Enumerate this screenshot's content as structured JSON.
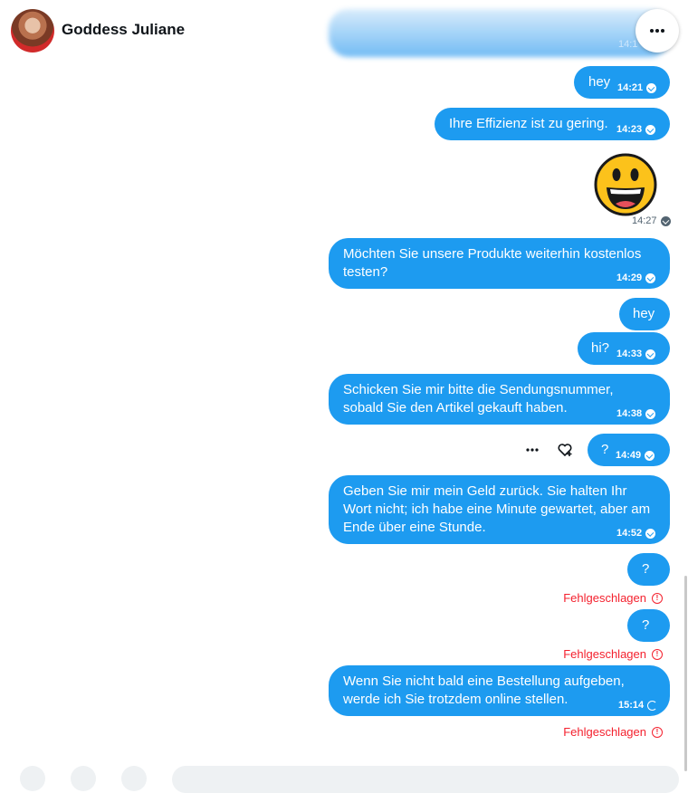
{
  "header": {
    "title": "Goddess Juliane"
  },
  "messages": [
    {
      "text": "hey",
      "time": "14:21",
      "status": "sent"
    },
    {
      "text": "Ihre Effizienz ist zu gering.",
      "time": "14:23",
      "status": "sent"
    },
    {
      "emoji": "grinning-face-icon",
      "time": "14:27",
      "status": "sent"
    },
    {
      "text": "Möchten Sie unsere Produkte weiterhin kostenlos testen?",
      "time": "14:29",
      "status": "sent"
    },
    {
      "text": "hey"
    },
    {
      "text": "hi?",
      "time": "14:33",
      "status": "sent"
    },
    {
      "text": "Schicken Sie mir bitte die Sendungsnummer, sobald Sie den Artikel gekauft haben.",
      "time": "14:38",
      "status": "sent"
    },
    {
      "text": "?",
      "time": "14:49",
      "status": "sent"
    },
    {
      "text": "Geben Sie mir mein Geld zurück. Sie halten Ihr Wort nicht; ich habe eine Minute gewartet, aber am Ende über eine Stunde.",
      "time": "14:52",
      "status": "sent"
    },
    {
      "text": "?",
      "status": "failed"
    },
    {
      "text": "?",
      "status": "failed"
    },
    {
      "text": "Wenn Sie nicht bald eine Bestellung aufgeben, werde ich Sie trotzdem online stellen.",
      "time": "15:14",
      "status": "sending"
    }
  ],
  "failed_label": "Fehlgeschlagen",
  "colors": {
    "bubble": "#1d9bf0",
    "failed": "#f4212e"
  }
}
